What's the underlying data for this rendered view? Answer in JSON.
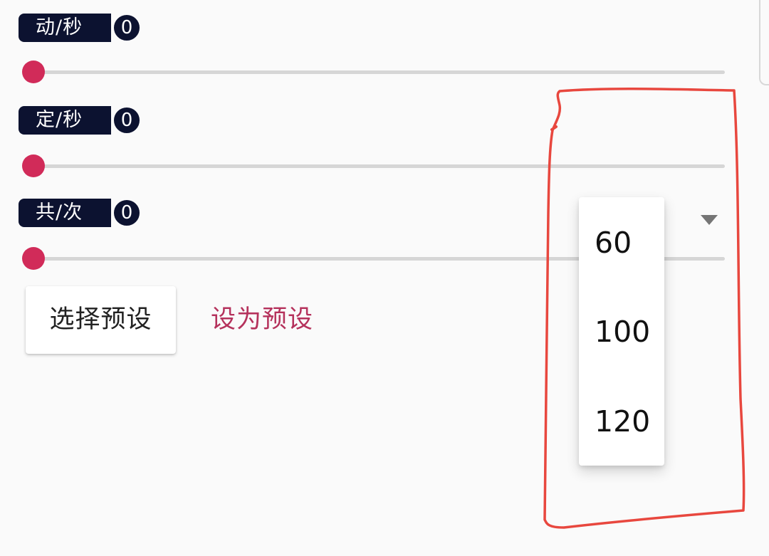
{
  "sliders": [
    {
      "label": "动/秒",
      "count": "0",
      "value_fraction": 0
    },
    {
      "label": "定/秒",
      "count": "0",
      "value_fraction": 0
    },
    {
      "label": "共/次",
      "count": "0",
      "value_fraction": 0
    }
  ],
  "buttons": {
    "select_preset": "选择预设",
    "set_as_preset": "设为预设"
  },
  "dropdown": {
    "options": [
      "60",
      "100",
      "120"
    ]
  },
  "colors": {
    "accent": "#d12b59",
    "label_background": "#0c1230",
    "link_text": "#b5325c",
    "annotation": "#e8473e"
  },
  "icons": {
    "dropdown_arrow": "triangle-down"
  }
}
